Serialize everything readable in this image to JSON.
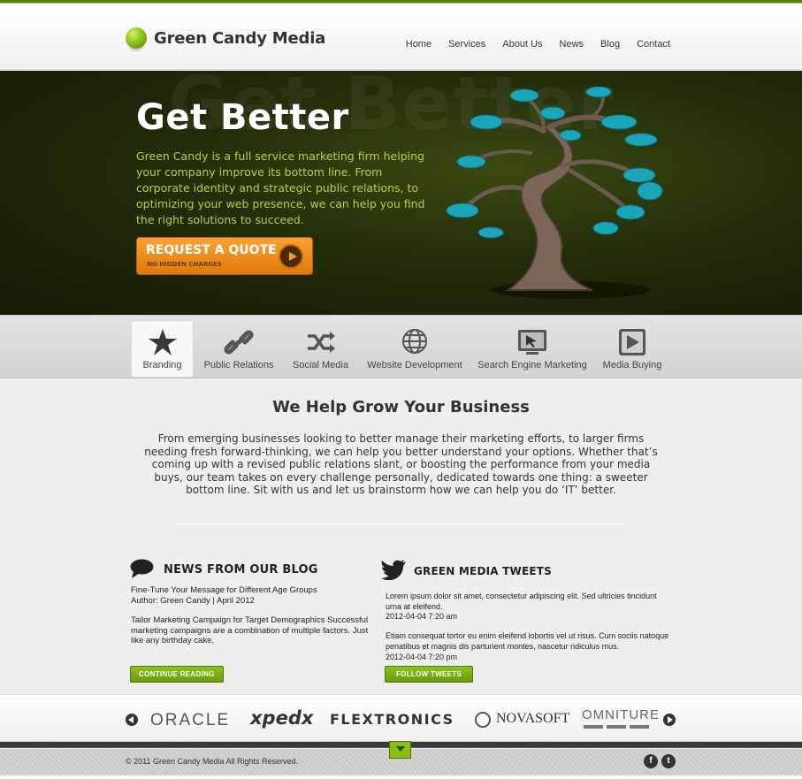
{
  "brand": {
    "name": "Green Candy Media"
  },
  "nav": [
    "Home",
    "Services",
    "About Us",
    "News",
    "Blog",
    "Contact"
  ],
  "hero": {
    "watermark": "Get Better",
    "title": "Get Better",
    "text": "Green Candy is a full service marketing firm helping your company improve its bottom line. From corporate identity and strategic public relations, to optimizing your web presence, we can help you find the right solutions to succeed.",
    "cta_main": "REQUEST A QUOTE",
    "cta_sub": "NO HIDDEN CHARGES"
  },
  "services": [
    {
      "label": "Branding",
      "icon": "star-icon",
      "active": true
    },
    {
      "label": "Public Relations",
      "icon": "link-icon"
    },
    {
      "label": "Social Media",
      "icon": "shuffle-icon"
    },
    {
      "label": "Website Development",
      "icon": "globe-icon"
    },
    {
      "label": "Search Engine Marketing",
      "icon": "monitor-icon"
    },
    {
      "label": "Media Buying",
      "icon": "play-icon"
    }
  ],
  "intro": {
    "title": "We Help Grow Your Business",
    "text": "From emerging businesses looking to better manage their marketing efforts, to larger firms needing fresh forward-thinking, we can help you better understand your options. Whether that’s coming up with a revised public relations slant, or boosting the performance from your media buys, our team takes on every challenge personally, dedicated towards one thing: a sweeter bottom line. Sit with us and let us brainstorm how we can help you do ‘IT’ better."
  },
  "blog": {
    "heading": "NEWS FROM OUR BLOG",
    "post1_title": "Fine-Tune Your Message for Different Age Groups",
    "post1_meta": "Author: Green Candy | April 2012",
    "post2_text": "Tailor Marketing Campaign for Target Demographics Successful marketing campaigns are a combination of multiple factors. Just like any birthday cake,",
    "button": "CONTINUE READING"
  },
  "tweets": {
    "heading": "GREEN MEDIA TWEETS",
    "t1_text": "Lorem ipsum dolor sit amet, consectetur adipiscing elit. Sed ultricies tincidunt urna at eleifend.",
    "t1_time": "2012-04-04 7:20 am",
    "t2_text": "Etiam consequat tortor eu enim eleifend lobortis vel ut risus. Cum sociis natoque penatibus et magnis dis parturient montes, nascetur ridiculus mus.",
    "t2_time": "2012-04-04 7:20 pm",
    "button": "FOLLOW TWEETS"
  },
  "clients": [
    "ORACLE",
    "xpedx",
    "FLEXTRONICS",
    "NOVASOFT",
    "OMNITURE"
  ],
  "footer": {
    "copyright": "© 2011  Green Candy Media  All Rights Reserved.",
    "facebook": "f",
    "twitter": "t"
  },
  "colors": {
    "accent": "#8cc21a",
    "hero_text": "#b6d23a",
    "cta": "#f08f1e"
  }
}
